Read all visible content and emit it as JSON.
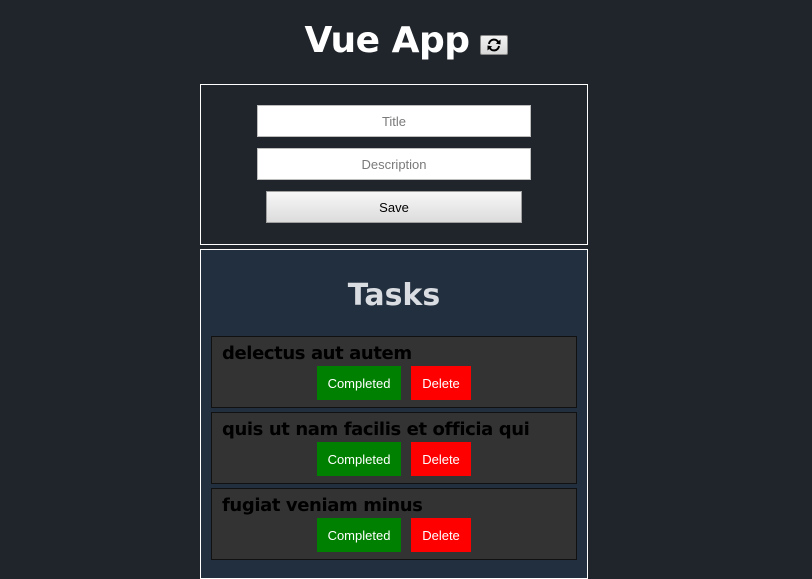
{
  "header": {
    "title": "Vue App",
    "refresh_icon": "refresh-icon"
  },
  "form": {
    "title_placeholder": "Title",
    "title_value": "",
    "description_placeholder": "Description",
    "description_value": "",
    "save_label": "Save"
  },
  "tasks": {
    "heading": "Tasks",
    "items": [
      {
        "title": "delectus aut autem",
        "completed_label": "Completed",
        "delete_label": "Delete"
      },
      {
        "title": "quis ut nam facilis et officia qui",
        "completed_label": "Completed",
        "delete_label": "Delete"
      },
      {
        "title": "fugiat veniam minus",
        "completed_label": "Completed",
        "delete_label": "Delete"
      }
    ]
  },
  "colors": {
    "background": "#20252b",
    "tasks_panel": "#222f3e",
    "task_card": "#333333",
    "completed_button": "#008000",
    "delete_button": "#ff0000"
  }
}
